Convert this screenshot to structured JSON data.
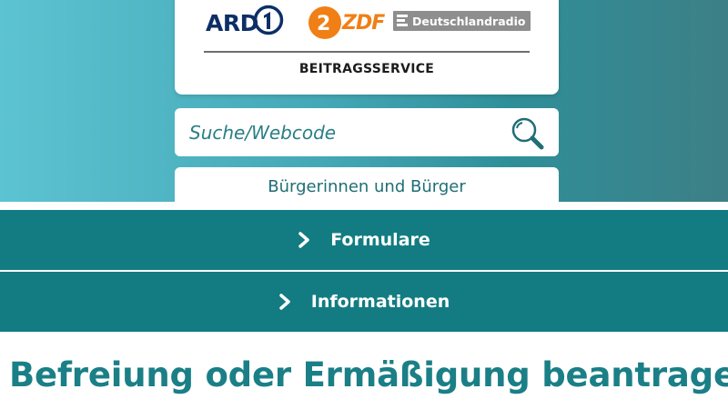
{
  "header": {
    "logos": {
      "ard": "ARD",
      "zdf": "ZDF",
      "deutschlandradio": "Deutschlandradio"
    },
    "service_name": "BEITRAGSSERVICE"
  },
  "search": {
    "placeholder": "Suche/Webcode",
    "icon": "search-icon"
  },
  "audience": {
    "label": "Bürgerinnen und Bürger"
  },
  "nav": {
    "items": [
      {
        "label": "Formulare",
        "icon": "chevron-right-icon"
      },
      {
        "label": "Informationen",
        "icon": "chevron-right-icon"
      }
    ]
  },
  "main": {
    "title": "Befreiung oder Ermäßigung beantragen"
  },
  "colors": {
    "accent": "#127c82",
    "title": "#1a7f86",
    "ard_blue": "#0d2f66",
    "zdf_orange": "#f07f16"
  }
}
